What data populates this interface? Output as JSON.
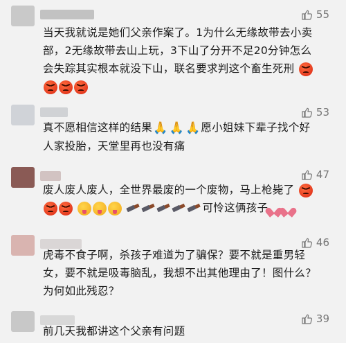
{
  "comments": [
    {
      "likes": "55",
      "text_a": "当天我就说是她们父亲作案了。1为什么无缘故带去小卖部，2无缘故带去山上玩，3下山了分开不足20分钟怎么会失踪其实根本就没下山，联名要求判这个畜生死刑",
      "avatar_color": "#c9c9c9",
      "name_color": "#9a9a9a"
    },
    {
      "likes": "53",
      "text_a": "真不愿相信这样的结果",
      "text_b": "愿小姐妹下辈子找个好人家投胎，天堂里再也没有痛",
      "avatar_color": "#d0d3d8",
      "name_color": "#b5b8bd"
    },
    {
      "likes": "47",
      "text_a": "废人废人废人，全世界最废的一个废物，马上枪毙了",
      "text_b": "可怜这俩孩子",
      "avatar_color": "#8a5a55",
      "name_color": "#b89c9a"
    },
    {
      "likes": "46",
      "text_a": "虎毒不食子啊，杀孩子难道为了骗保？要不就是重男轻女，要不就是吸毒脑乱，我想不出其他理由了！图什么？为何如此残忍？",
      "avatar_color": "#d9b4b0",
      "name_color": "#c7c0c0"
    },
    {
      "likes": "39",
      "text_a": "前几天我都讲这个父亲有问题",
      "avatar_color": "#c8c8c8",
      "name_color": "#c2c2c2"
    }
  ],
  "icons": {
    "like": "thumbs-up-icon",
    "angry": "angry-face-emoji",
    "pray": "praying-hands-emoji",
    "tongue": "tongue-face-emoji",
    "knife": "kitchen-knife-emoji",
    "broken": "broken-heart-emoji"
  },
  "colors": {
    "background": "#f2f2f2",
    "text": "#1c1c1c",
    "like": "#777777"
  }
}
